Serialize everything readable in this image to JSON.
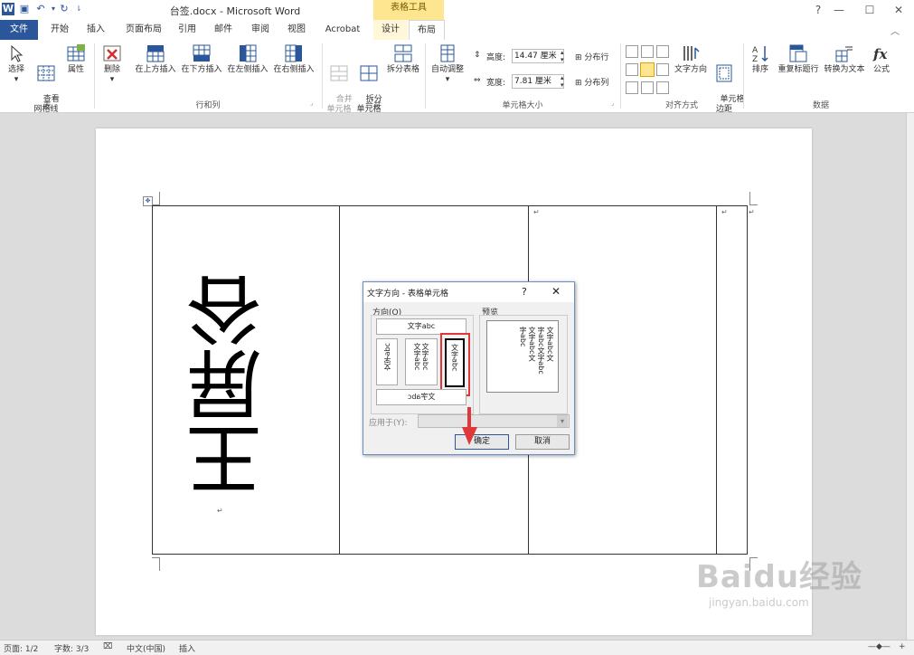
{
  "title_bar": {
    "title": "台签.docx - Microsoft Word",
    "context_tab": "表格工具",
    "qat_icons": [
      "word-app-icon",
      "save-icon",
      "undo-icon",
      "redo-icon",
      "customize-icon"
    ]
  },
  "tabs": [
    "文件",
    "开始",
    "插入",
    "页面布局",
    "引用",
    "邮件",
    "审阅",
    "视图",
    "Acrobat",
    "设计",
    "布局"
  ],
  "ribbon": {
    "group_table": {
      "label": "表",
      "select": "选择",
      "view_gridlines": "查看\n网格线",
      "properties": "属性"
    },
    "group_rows_cols": {
      "label": "行和列",
      "delete": "删除",
      "insert_above": "在上方插入",
      "insert_below": "在下方插入",
      "insert_left": "在左侧插入",
      "insert_right": "在右侧插入"
    },
    "group_merge": {
      "label": "合并",
      "merge_cells": "合并\n单元格",
      "split_cells": "拆分\n单元格",
      "split_table": "拆分表格"
    },
    "group_cell_size": {
      "label": "单元格大小",
      "autofit": "自动调整",
      "height_label": "高度:",
      "height_value": "14.47 厘米",
      "width_label": "宽度:",
      "width_value": "7.81 厘米",
      "distribute_rows": "分布行",
      "distribute_cols": "分布列"
    },
    "group_alignment": {
      "label": "对齐方式",
      "text_direction": "文字方向",
      "cell_margins": "单元格\n边距"
    },
    "group_data": {
      "label": "数据",
      "sort": "排序",
      "repeat_header": "重复标题行",
      "convert_to_text": "转换为文本",
      "formula": "公式"
    }
  },
  "document": {
    "cell_text": "王屏谷",
    "paragraph_marks": [
      "↵",
      "↵",
      "↵",
      "↵"
    ]
  },
  "dialog": {
    "title": "文字方向 - 表格单元格",
    "help": "?",
    "close": "✕",
    "direction_label": "方向(O)",
    "preview_label": "预览",
    "opt_horizontal": "文字abc",
    "opt_vertical_rotated": "文字abc",
    "opt_vertical_stacked": "文字abc\n文字abc",
    "opt_vertical_selected": "文字abc",
    "opt_horizontal_flipped": "文字abc",
    "preview_lines": [
      "文字abc文",
      "字abc文字abc",
      "文字abc文",
      "字abc"
    ],
    "apply_to_label": "应用于(Y):",
    "apply_to_value": "",
    "ok": "确定",
    "cancel": "取消"
  },
  "status_bar": {
    "page": "页面: 1/2",
    "words": "字数: 3/3",
    "language": "中文(中国)",
    "mode": "插入"
  },
  "watermark": {
    "brand": "Baidu经验",
    "url": "jingyan.baidu.com"
  },
  "colors": {
    "file_tab": "#2b579a",
    "context_tab": "#fde68f",
    "highlight": "#e0373b"
  }
}
